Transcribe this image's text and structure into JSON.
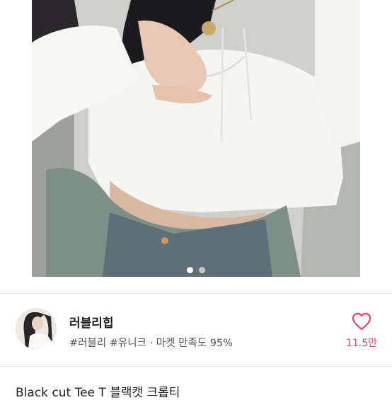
{
  "carousel": {
    "image_alt": "product-photo",
    "page_count": 2,
    "current_index": 1
  },
  "seller": {
    "name": "러블리힙",
    "tags": "#러블리 #유니크 · 마켓 만족도 95%"
  },
  "like": {
    "icon": "heart-outline-icon",
    "count": "11.5만",
    "color": "#e2436b"
  },
  "product": {
    "title": "Black cut Tee T 블랙캣 크롭티"
  }
}
